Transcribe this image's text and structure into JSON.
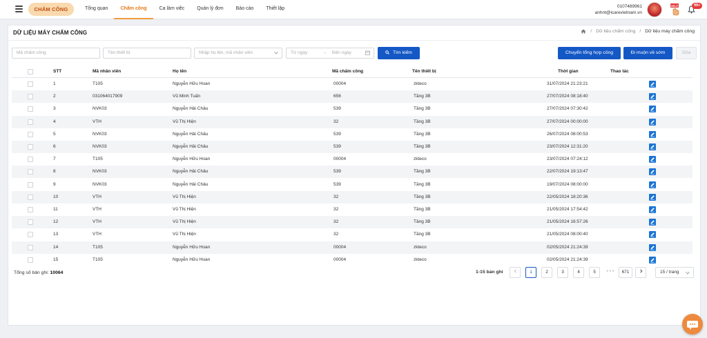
{
  "header": {
    "brand": "CHẤM CÔNG",
    "nav": [
      "Tổng quan",
      "Chấm công",
      "Ca làm việc",
      "Quản lý đơn",
      "Báo cáo",
      "Thiết lập"
    ],
    "active_nav": 1,
    "account_id": "0107489961",
    "account_email": "anhnt@icarevietnam.vn",
    "notification_badge": "99+",
    "accent": "#f29a3a"
  },
  "page": {
    "title": "DỮ LIỆU MÁY CHẤM CÔNG",
    "breadcrumb": [
      "Dữ liệu chấm công",
      "Dữ liệu máy chấm công"
    ]
  },
  "filters": {
    "code_placeholder": "Mã chấm công",
    "device_placeholder": "Tên thiết bị",
    "employee_placeholder": "Nhập họ tên, mã nhân viên",
    "from_placeholder": "Từ ngày",
    "to_placeholder": "Đến ngày",
    "search_label": "Tìm kiếm",
    "sync_label": "Chuyển tổng hợp công",
    "late_label": "Đi muộn về sớm",
    "edit_label": "Sửa"
  },
  "table": {
    "columns": [
      "STT",
      "Mã nhân viên",
      "Họ tên",
      "Mã chấm công",
      "Tên thiết bị",
      "Thời gian",
      "Thao tác"
    ],
    "rows": [
      [
        "1",
        "T105",
        "Nguyễn Hữu Hoan",
        "00004",
        "zkteco",
        "31/07/2024 21:23:21"
      ],
      [
        "2",
        "031064017909",
        "Vũ Minh Tuấn",
        "656",
        "Tầng 3B",
        "27/07/2024 08:18:40"
      ],
      [
        "3",
        "NVK03",
        "Nguyễn Hải Châu",
        "539",
        "Tầng 3B",
        "27/07/2024 07:30:42"
      ],
      [
        "4",
        "VTH",
        "Vũ Thị Hiện",
        "32",
        "Tầng 3B",
        "27/07/2024 00:00:00"
      ],
      [
        "5",
        "NVK03",
        "Nguyễn Hải Châu",
        "539",
        "Tầng 3B",
        "26/07/2024 08:00:53"
      ],
      [
        "6",
        "NVK03",
        "Nguyễn Hải Châu",
        "539",
        "Tầng 3B",
        "23/07/2024 12:31:20"
      ],
      [
        "7",
        "T105",
        "Nguyễn Hữu Hoan",
        "00004",
        "zkteco",
        "23/07/2024 07:24:12"
      ],
      [
        "8",
        "NVK03",
        "Nguyễn Hải Châu",
        "539",
        "Tầng 3B",
        "22/07/2024 19:13:47"
      ],
      [
        "9",
        "NVK03",
        "Nguyễn Hải Châu",
        "539",
        "Tầng 3B",
        "19/07/2024 08:00:00"
      ],
      [
        "10",
        "VTH",
        "Vũ Thị Hiện",
        "32",
        "Tầng 3B",
        "22/05/2024 18:20:36"
      ],
      [
        "11",
        "VTH",
        "Vũ Thị Hiện",
        "32",
        "Tầng 3B",
        "21/05/2024 17:54:42"
      ],
      [
        "12",
        "VTH",
        "Vũ Thị Hiện",
        "32",
        "Tầng 3B",
        "21/05/2024 16:57:26"
      ],
      [
        "13",
        "VTH",
        "Vũ Thị Hiện",
        "32",
        "Tầng 3B",
        "21/05/2024 08:00:40"
      ],
      [
        "14",
        "T105",
        "Nguyễn Hữu Hoan",
        "00004",
        "zkteco",
        "02/05/2024 21:24:39"
      ],
      [
        "15",
        "T105",
        "Nguyễn Hữu Hoan",
        "00004",
        "zkteco",
        "02/05/2024 21:24:39"
      ]
    ]
  },
  "footer": {
    "total_label": "Tổng số bản ghi:",
    "total_value": "10064",
    "range": "1-15 bản ghi",
    "pages": [
      "1",
      "2",
      "3",
      "4",
      "5"
    ],
    "ellipsis": "• • •",
    "last_page": "671",
    "page_size": "15 / trang",
    "prev_icon": "chevron-left-icon",
    "next_icon": "chevron-right-icon"
  }
}
